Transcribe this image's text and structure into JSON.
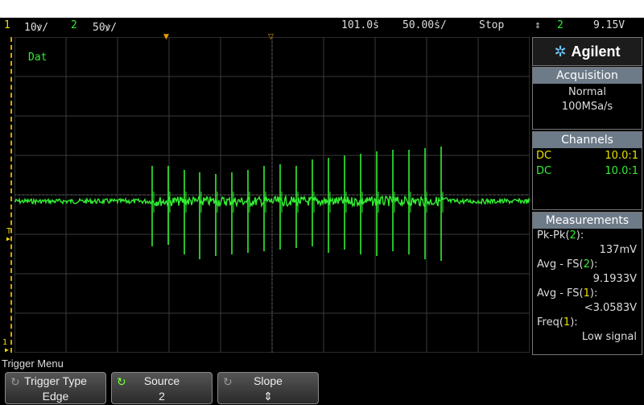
{
  "status_bar": {
    "ch1_num": "1",
    "ch1_scale": "10ꝟ/",
    "ch2_num": "2",
    "ch2_scale": "50ꝟ/",
    "time_pos": "101.0ṡ",
    "time_scale": "50.00ṡ/",
    "run_state": "Stop",
    "trigger_icon": "⇕",
    "trigger_source": "2",
    "trigger_level": "9.15V"
  },
  "screen": {
    "label": "Dat",
    "trigger_level_marker": "T",
    "ground_marker": "1"
  },
  "logo": {
    "brand": "Agilent"
  },
  "acquisition": {
    "header": "Acquisition",
    "mode": "Normal",
    "rate": "100MSa/s"
  },
  "channels": {
    "header": "Channels",
    "rows": [
      {
        "coupling": "DC",
        "probe": "10.0:1",
        "color": "#e8e000"
      },
      {
        "coupling": "DC",
        "probe": "10.0:1",
        "color": "#33ee33"
      }
    ]
  },
  "measurements": {
    "header": "Measurements",
    "items": [
      {
        "name": "Pk-Pk",
        "channel": "2",
        "value": "137mV"
      },
      {
        "name": "Avg - FS",
        "channel": "2",
        "value": "9.1933V"
      },
      {
        "name": "Avg - FS",
        "channel": "1",
        "value": "<3.0583V"
      },
      {
        "name": "Freq",
        "channel": "1",
        "value": "Low signal"
      }
    ]
  },
  "menu": {
    "title": "Trigger Menu",
    "softkeys": [
      {
        "label": "Trigger Type",
        "value": "Edge"
      },
      {
        "label": "Source",
        "value": "2"
      },
      {
        "label": "Slope",
        "value": "⇕"
      }
    ]
  },
  "colors": {
    "trace": "#33ee33",
    "ch1": "#e8e000",
    "grid": "#3a3a3a",
    "panel_header": "#6d7a88"
  }
}
